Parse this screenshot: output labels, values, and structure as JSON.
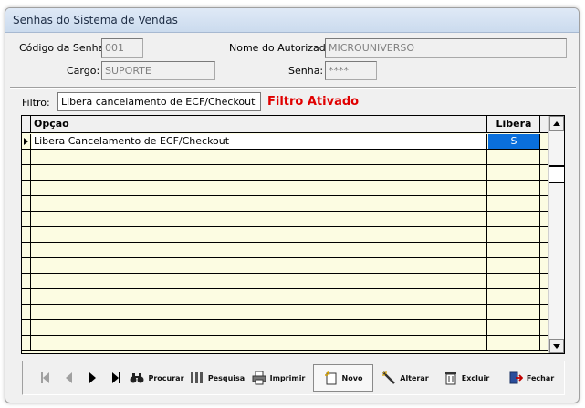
{
  "window": {
    "title": "Senhas do Sistema de Vendas"
  },
  "form": {
    "codigo_label": "Código da Senha:",
    "codigo_value": "001",
    "nome_label": "Nome do Autorizado:",
    "nome_value": "MICROUNIVERSO",
    "cargo_label": "Cargo:",
    "cargo_value": "SUPORTE",
    "senha_label": "Senha:",
    "senha_value": "****"
  },
  "filter": {
    "label": "Filtro:",
    "value": "Libera cancelamento de ECF/Checkout",
    "status": "Filtro Ativado",
    "status_color": "#e00000"
  },
  "grid": {
    "columns": [
      "Opção",
      "Libera"
    ],
    "rows": [
      {
        "opcao": "Libera Cancelamento de ECF/Checkout",
        "libera": "S"
      }
    ],
    "selected_color": "#0a6fdc",
    "row_background": "#fcfce2"
  },
  "toolbar": {
    "procurar": "Procurar",
    "pesquisa": "Pesquisa",
    "imprimir": "Imprimir",
    "novo": "Novo",
    "alterar": "Alterar",
    "excluir": "Excluir",
    "fechar": "Fechar"
  }
}
